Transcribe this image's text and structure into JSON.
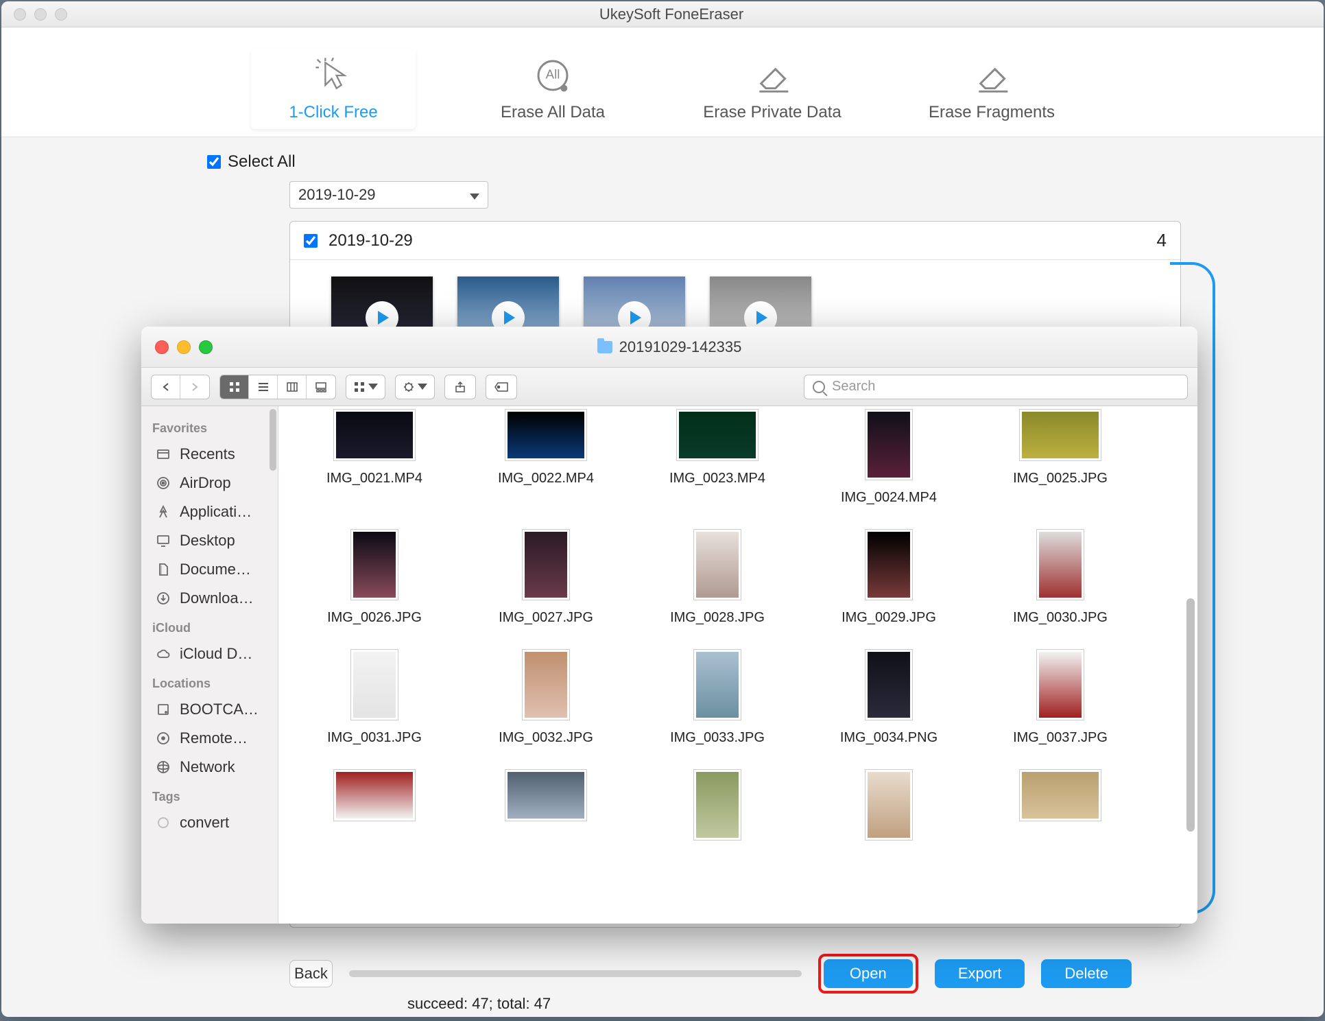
{
  "app": {
    "title": "UkeySoft FoneEraser",
    "tabs": [
      {
        "label": "1-Click Free",
        "active": true
      },
      {
        "label": "Erase All Data"
      },
      {
        "label": "Erase Private Data"
      },
      {
        "label": "Erase Fragments"
      }
    ],
    "select_all": "Select All",
    "date_dropdown": "2019-10-29",
    "date_header": {
      "label": "2019-10-29",
      "count": "4"
    },
    "buttons": {
      "back": "Back",
      "open": "Open",
      "export": "Export",
      "delete": "Delete"
    },
    "status": "succeed: 47; total: 47"
  },
  "finder": {
    "title": "20191029-142335",
    "search_placeholder": "Search",
    "sidebar": {
      "favorites_label": "Favorites",
      "favorites": [
        {
          "label": "Recents",
          "icon": "recents"
        },
        {
          "label": "AirDrop",
          "icon": "airdrop"
        },
        {
          "label": "Applicati…",
          "icon": "apps"
        },
        {
          "label": "Desktop",
          "icon": "desktop"
        },
        {
          "label": "Docume…",
          "icon": "documents"
        },
        {
          "label": "Downloa…",
          "icon": "downloads"
        }
      ],
      "icloud_label": "iCloud",
      "icloud": [
        {
          "label": "iCloud D…",
          "icon": "cloud"
        }
      ],
      "locations_label": "Locations",
      "locations": [
        {
          "label": "BOOTCA…",
          "icon": "disk"
        },
        {
          "label": "Remote…",
          "icon": "remote"
        },
        {
          "label": "Network",
          "icon": "network"
        }
      ],
      "tags_label": "Tags",
      "tags": [
        {
          "label": "convert",
          "icon": "tag"
        }
      ]
    },
    "files": [
      {
        "name": "IMG_0021.MP4",
        "shape": "wide",
        "c": "c0"
      },
      {
        "name": "IMG_0022.MP4",
        "shape": "wide",
        "c": "c1"
      },
      {
        "name": "IMG_0023.MP4",
        "shape": "wide",
        "c": "c2"
      },
      {
        "name": "IMG_0024.MP4",
        "shape": "tall",
        "c": "c3"
      },
      {
        "name": "IMG_0025.JPG",
        "shape": "wide",
        "c": "c4"
      },
      {
        "name": "IMG_0026.JPG",
        "shape": "tall",
        "c": "c5"
      },
      {
        "name": "IMG_0027.JPG",
        "shape": "tall",
        "c": "c6"
      },
      {
        "name": "IMG_0028.JPG",
        "shape": "tall",
        "c": "c7"
      },
      {
        "name": "IMG_0029.JPG",
        "shape": "tall",
        "c": "c8"
      },
      {
        "name": "IMG_0030.JPG",
        "shape": "tall",
        "c": "c9"
      },
      {
        "name": "IMG_0031.JPG",
        "shape": "tall",
        "c": "c10"
      },
      {
        "name": "IMG_0032.JPG",
        "shape": "tall",
        "c": "c11"
      },
      {
        "name": "IMG_0033.JPG",
        "shape": "tall",
        "c": "c12"
      },
      {
        "name": "IMG_0034.PNG",
        "shape": "tall",
        "c": "c13"
      },
      {
        "name": "IMG_0037.JPG",
        "shape": "tall",
        "c": "c14"
      },
      {
        "name": "",
        "shape": "wide",
        "c": "c15"
      },
      {
        "name": "",
        "shape": "wide",
        "c": "c16"
      },
      {
        "name": "",
        "shape": "tall",
        "c": "c17"
      },
      {
        "name": "",
        "shape": "tall",
        "c": "c18"
      },
      {
        "name": "",
        "shape": "wide",
        "c": "c19"
      }
    ]
  }
}
